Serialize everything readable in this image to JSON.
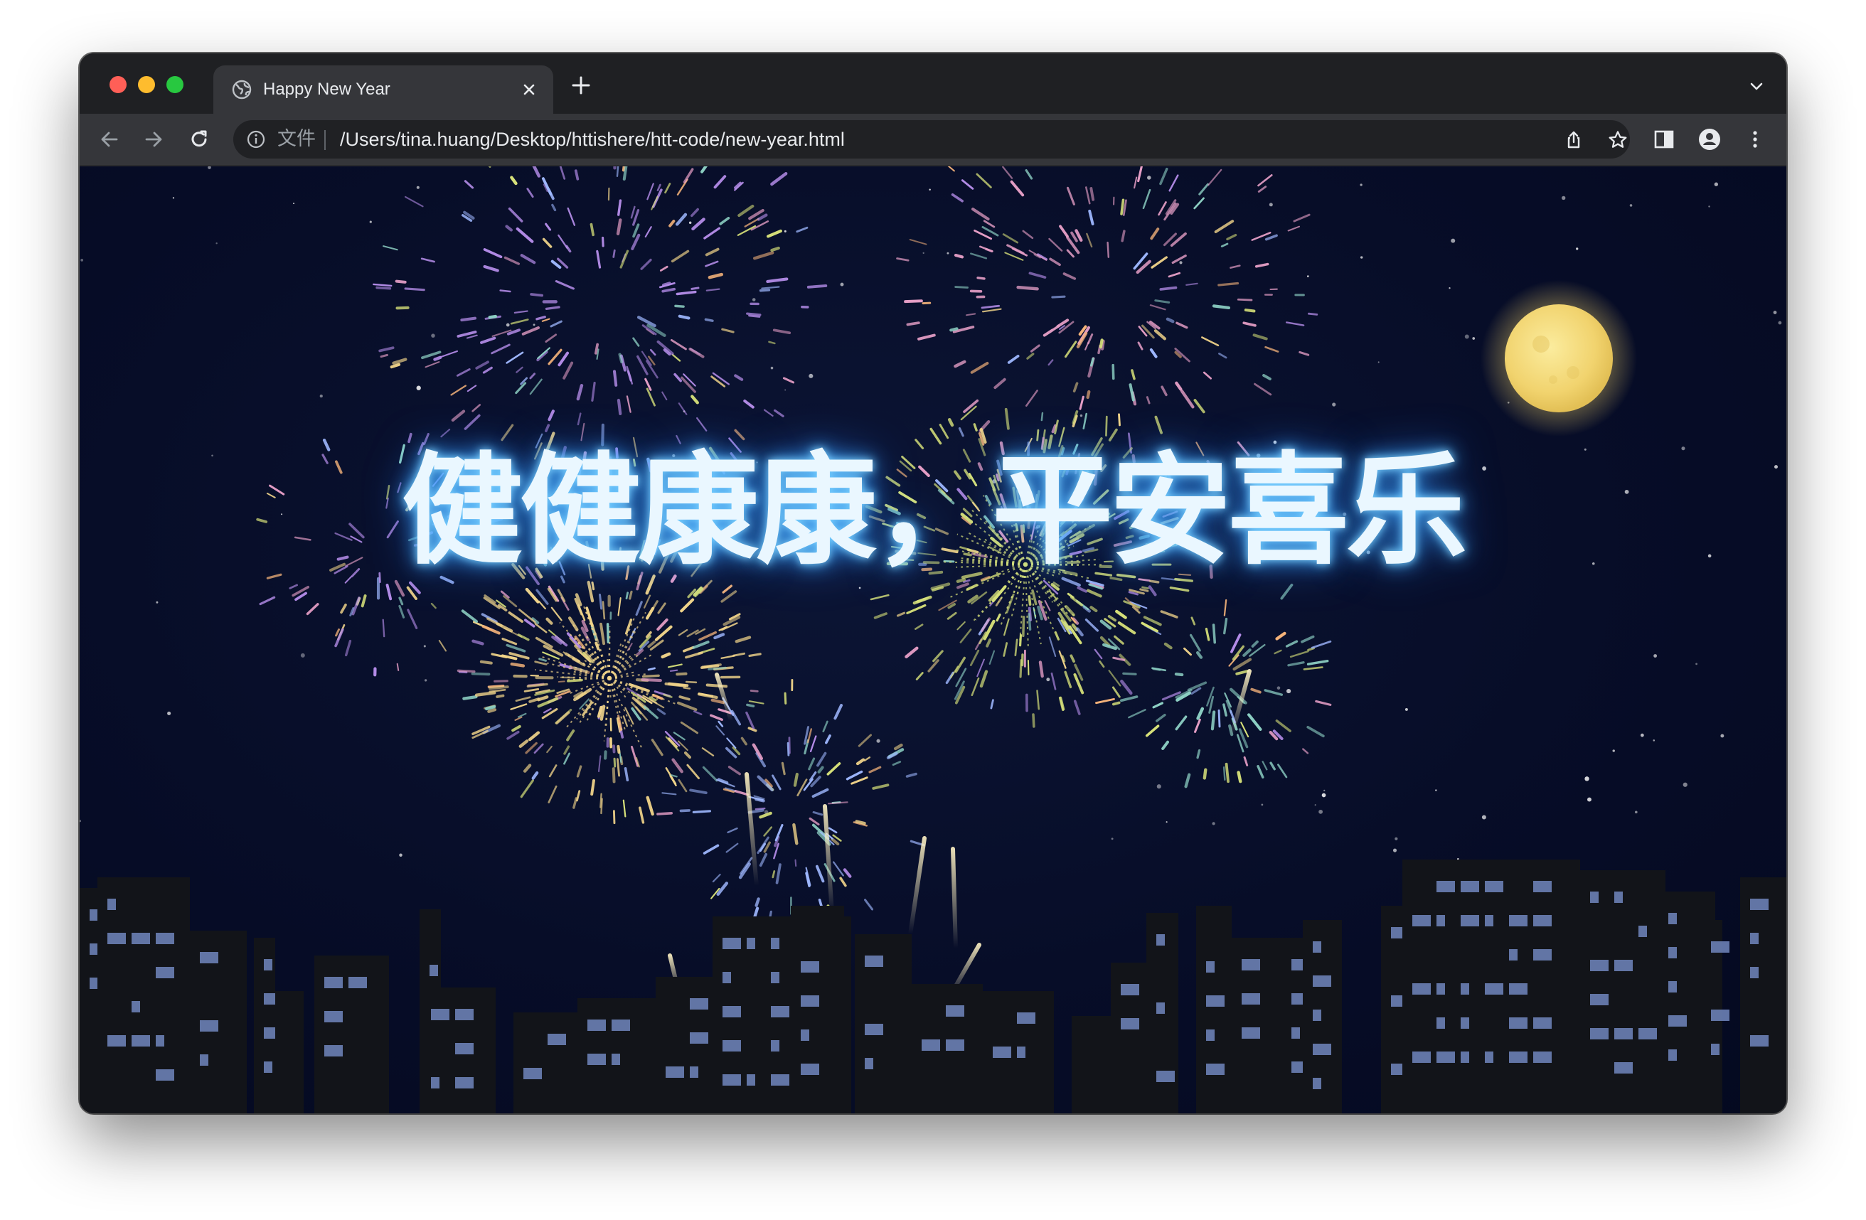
{
  "browser": {
    "tab": {
      "title": "Happy New Year",
      "icon": "globe-icon"
    },
    "address": {
      "scheme_label": "文件",
      "url": "/Users/tina.huang/Desktop/httishere/htt-code/new-year.html"
    },
    "colors": {
      "chrome_dark": "#1f2023",
      "toolbar": "#35363a",
      "omnibox": "#202124",
      "text": "#e8eaed"
    }
  },
  "page": {
    "greeting": "健健康康，平安喜乐",
    "colors": {
      "sky": "#060c26",
      "moon": "#f3d97a",
      "building": "#121419",
      "window_light": "#6b7fb5",
      "firework_gold": "#f2d58a",
      "firework_green": "#d8e27a",
      "firework_purple": "#b48ce8"
    }
  }
}
